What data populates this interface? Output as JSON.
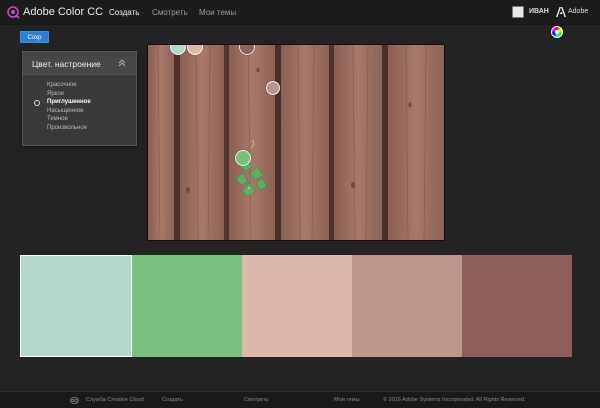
{
  "app": {
    "title": "Adobe Color CC"
  },
  "nav": {
    "items": [
      {
        "label": "Создать",
        "active": true
      },
      {
        "label": "Смотреть",
        "active": false
      },
      {
        "label": "Мои темы",
        "active": false
      }
    ]
  },
  "user": {
    "name": "ИВАН",
    "brand_label": "Adobe"
  },
  "toolbar": {
    "save_label": "Сохр"
  },
  "mood": {
    "title": "Цвет. настроение",
    "options": [
      {
        "label": "Красочное",
        "selected": false
      },
      {
        "label": "Яркое",
        "selected": false
      },
      {
        "label": "Приглушенное",
        "selected": true
      },
      {
        "label": "Насыщенное",
        "selected": false
      },
      {
        "label": "Темное",
        "selected": false
      },
      {
        "label": "Произвольное",
        "selected": false
      }
    ]
  },
  "swatches": {
    "colors": [
      "#b6d7cb",
      "#7bc17e",
      "#dcb8ac",
      "#c0958c",
      "#8f5f5d"
    ],
    "active_index": 0
  },
  "footer": {
    "cc_label": "Служба Creative Cloud",
    "links": [
      "Создать",
      "Смотреть",
      "Мои темы"
    ],
    "copyright": "© 2016 Adobe Systems Incorporated. All Rights Reserved."
  },
  "colors": {
    "accent": "#2d7fd6",
    "background": "#232323",
    "panel": "#3a3a3a"
  },
  "icons": [
    "adobe-color-logo-icon",
    "color-wheel-icon",
    "chevron-up-icon",
    "adobe-logo-icon",
    "creative-cloud-icon"
  ]
}
